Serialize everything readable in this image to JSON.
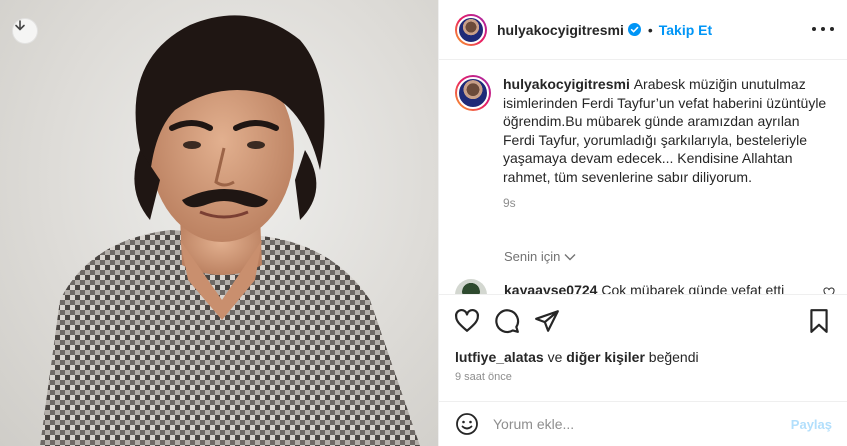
{
  "post": {
    "username": "hulyakocyigitresmi",
    "separator": "•",
    "follow_label": "Takip Et",
    "caption": "Arabesk müziğin unutulmaz isimlerinden Ferdi Tayfur’un vefat haberini üzüntüyle öğrendim.Bu mübarek günde aramızdan ayrılan Ferdi Tayfur, yorumladığı şarkılarıyla, besteleriyle yaşamaya devam edecek... Kendisine Allahtan rahmet, tüm sevenlerine sabır diliyorum.",
    "caption_time": "9s",
    "for_you_label": "Senin için"
  },
  "comments": [
    {
      "username": "kayaayse0724",
      "text": "Çok mübarek günde vefat etti"
    }
  ],
  "likes": {
    "first_user": "lutfiye_alatas",
    "connector": "ve",
    "others": "diğer kişiler",
    "suffix": "beğendi"
  },
  "posted_time": "9 saat önce",
  "comment_box": {
    "placeholder": "Yorum ekle...",
    "post_label": "Paylaş"
  },
  "icons": {
    "download": "download-icon",
    "verified": "verified-badge-icon",
    "more": "more-options-icon",
    "like": "heart-icon",
    "comment": "comment-icon",
    "share": "share-icon",
    "save": "bookmark-icon",
    "emoji": "emoji-icon",
    "chevron": "chevron-down-icon"
  },
  "colors": {
    "accent": "#0095f6",
    "post_disabled": "#b2dffc",
    "muted": "#8e8e8e"
  }
}
